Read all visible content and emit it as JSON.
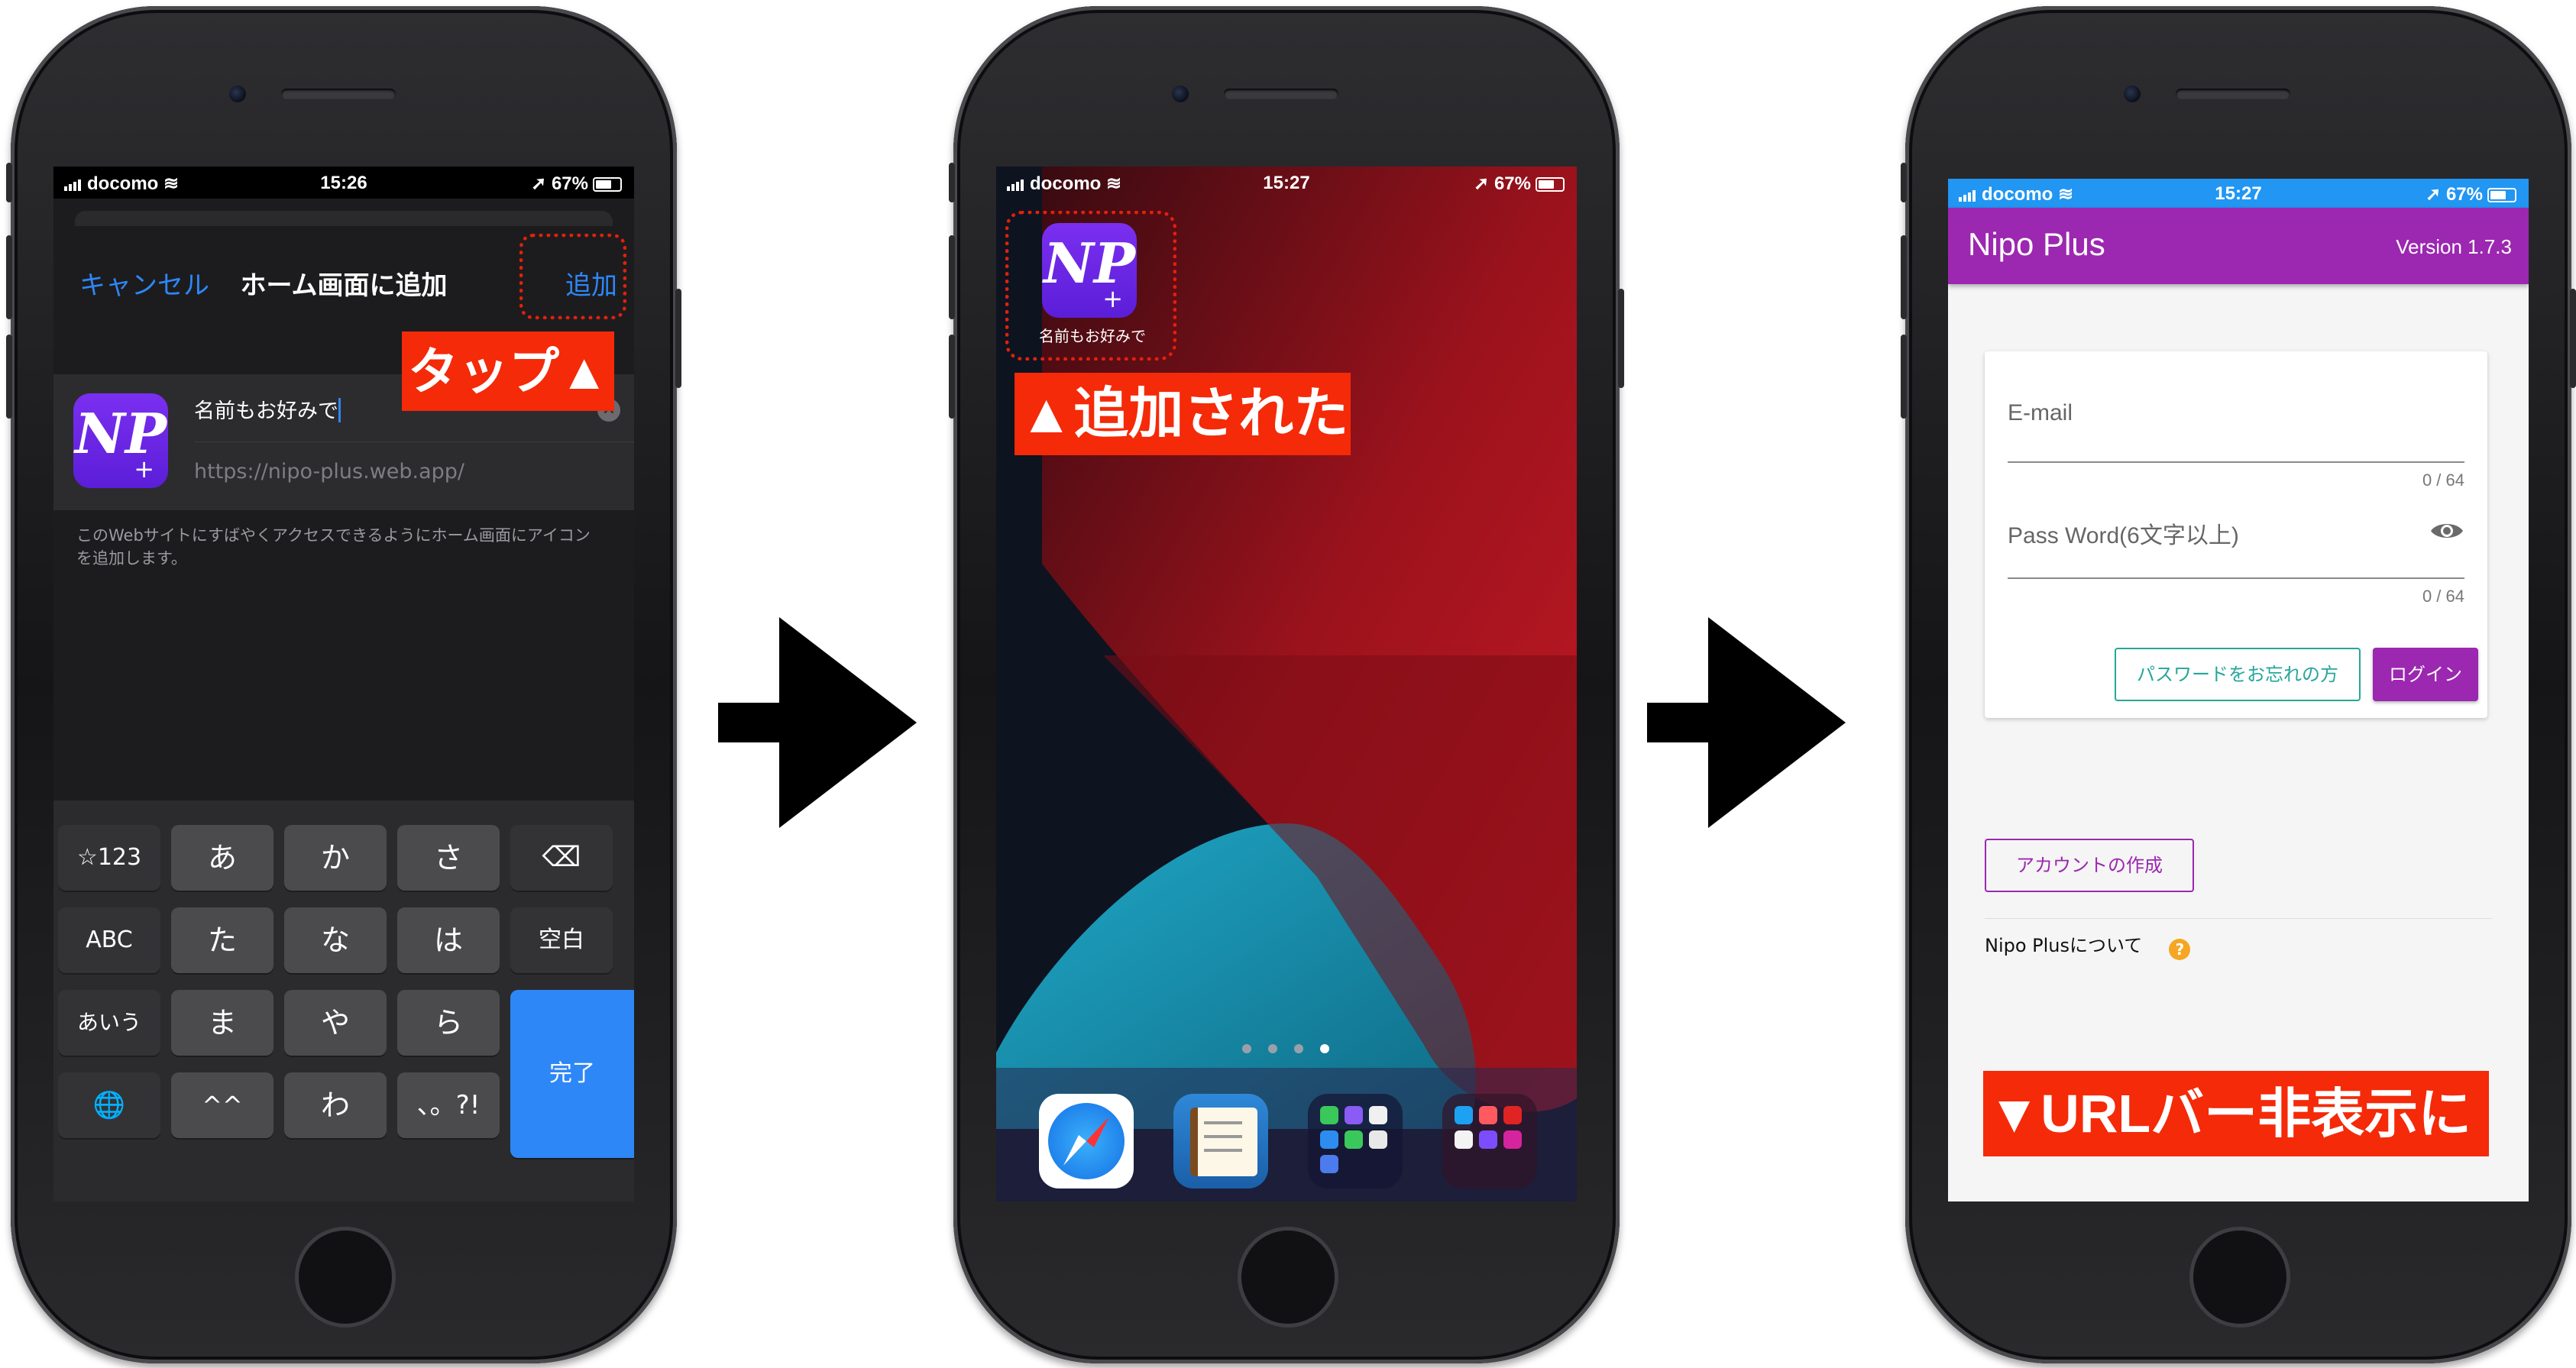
{
  "status_bar": {
    "carrier": "docomo",
    "battery": "67%",
    "times": [
      "15:26",
      "15:27",
      "15:27"
    ]
  },
  "screen1": {
    "cancel": "キャンセル",
    "title": "ホーム画面に追加",
    "add": "追加",
    "tap_label": "タップ▲",
    "name_value": "名前もお好みで",
    "url": "https://nipo-plus.web.app/",
    "description": "このWebサイトにすばやくアクセスできるようにホーム画面にアイコンを追加します。",
    "keyboard": {
      "row1": [
        "☆123",
        "あ",
        "か",
        "さ",
        "⌫"
      ],
      "row2": [
        "ABC",
        "た",
        "な",
        "は",
        "空白"
      ],
      "row3": [
        "あいう",
        "ま",
        "や",
        "ら"
      ],
      "row4": [
        "🌐",
        "^^",
        "わ",
        "、。?!"
      ],
      "done": "完了"
    }
  },
  "screen2": {
    "app_label": "名前もお好みで",
    "added_label": "▲追加された",
    "icon_text": "NP"
  },
  "screen3": {
    "app_title": "Nipo Plus",
    "version": "Version 1.7.3",
    "email_label": "E-mail",
    "email_counter": "0 / 64",
    "password_label": "Pass Word(6文字以上)",
    "password_counter": "0 / 64",
    "forgot_button": "パスワードをお忘れの方",
    "login_button": "ログイン",
    "create_account": "アカウントの作成",
    "about": "Nipo Plusについて",
    "url_bar_label": "▼URLバー非表示に"
  },
  "colors": {
    "ios_blue": "#2e87f7",
    "purple_header": "#9c27b0",
    "teal": "#26a69a",
    "red_label": "#f42a09",
    "icon_purple": "#6a24e4"
  }
}
